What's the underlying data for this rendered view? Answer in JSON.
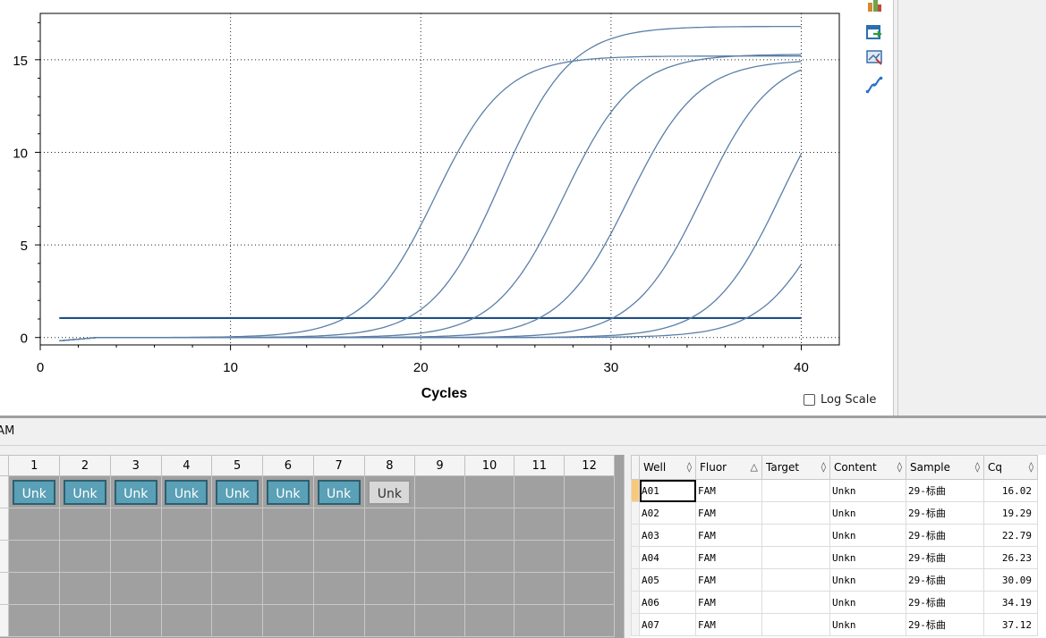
{
  "chart_data": {
    "type": "line",
    "xlabel": "Cycles",
    "ylabel": "",
    "xlim": [
      0,
      42
    ],
    "ylim": [
      -0.4,
      17.5
    ],
    "xticks": [
      0,
      10,
      20,
      30,
      40
    ],
    "yticks": [
      0,
      5,
      10,
      15
    ],
    "grid": true,
    "threshold": 1.05,
    "curves": [
      {
        "well": "A01",
        "cq": 16.02,
        "plateau": 15.2
      },
      {
        "well": "A02",
        "cq": 19.29,
        "plateau": 16.8
      },
      {
        "well": "A03",
        "cq": 22.79,
        "plateau": 15.3
      },
      {
        "well": "A04",
        "cq": 26.23,
        "plateau": 15.0
      },
      {
        "well": "A05",
        "cq": 30.09,
        "plateau": 15.3
      },
      {
        "well": "A06",
        "cq": 34.19,
        "plateau": 15.5
      },
      {
        "well": "A07",
        "cq": 37.12,
        "plateau": 14.0
      }
    ],
    "x_range": [
      1,
      40
    ]
  },
  "colors": {
    "curve": "#5a7fa8",
    "threshold": "#1f4e85",
    "well_fill": "#5aa0b6"
  },
  "log_scale_label": "Log Scale",
  "fluor_tab_label": "FAM",
  "toolbar_icons": [
    "chart-icon",
    "export-icon",
    "zoom-icon",
    "curve-icon"
  ],
  "plate": {
    "columns": [
      "1",
      "2",
      "3",
      "4",
      "5",
      "6",
      "7",
      "8",
      "9",
      "10",
      "11",
      "12"
    ],
    "row1": [
      "Unk",
      "Unk",
      "Unk",
      "Unk",
      "Unk",
      "Unk",
      "Unk",
      "Unk",
      "",
      "",
      "",
      ""
    ]
  },
  "results": {
    "headers": [
      {
        "label": "Well",
        "sort": "◊"
      },
      {
        "label": "Fluor",
        "sort": "△"
      },
      {
        "label": "Target",
        "sort": "◊"
      },
      {
        "label": "Content",
        "sort": "◊"
      },
      {
        "label": "Sample",
        "sort": "◊"
      },
      {
        "label": "Cq",
        "sort": "◊"
      }
    ],
    "rows": [
      [
        "A01",
        "FAM",
        "",
        "Unkn",
        "29-标曲",
        "16.02"
      ],
      [
        "A02",
        "FAM",
        "",
        "Unkn",
        "29-标曲",
        "19.29"
      ],
      [
        "A03",
        "FAM",
        "",
        "Unkn",
        "29-标曲",
        "22.79"
      ],
      [
        "A04",
        "FAM",
        "",
        "Unkn",
        "29-标曲",
        "26.23"
      ],
      [
        "A05",
        "FAM",
        "",
        "Unkn",
        "29-标曲",
        "30.09"
      ],
      [
        "A06",
        "FAM",
        "",
        "Unkn",
        "29-标曲",
        "34.19"
      ],
      [
        "A07",
        "FAM",
        "",
        "Unkn",
        "29-标曲",
        "37.12"
      ]
    ]
  }
}
